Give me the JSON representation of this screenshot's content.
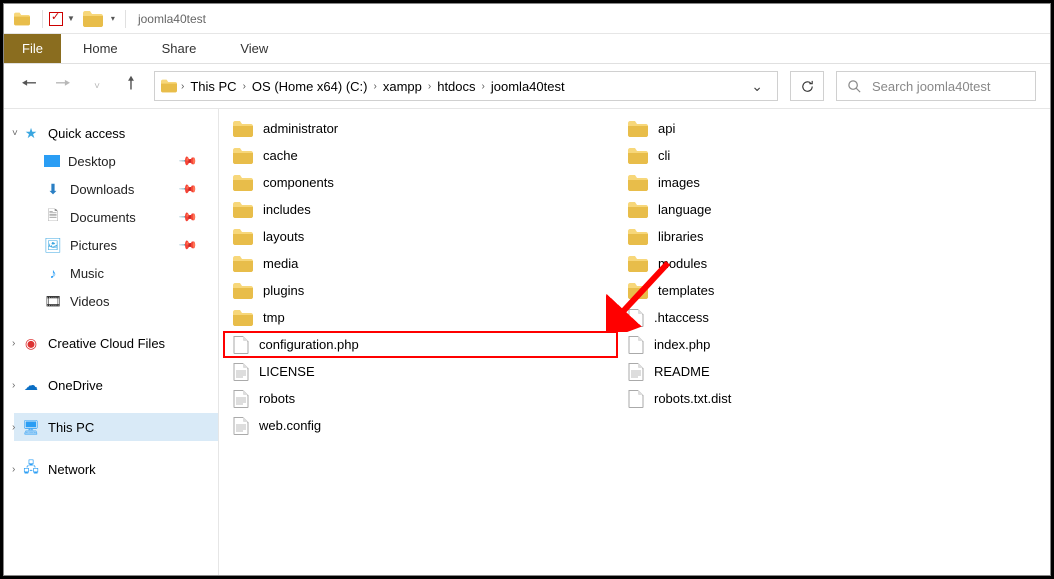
{
  "window": {
    "title": "joomla40test"
  },
  "ribbon": {
    "file": "File",
    "tabs": [
      "Home",
      "Share",
      "View"
    ]
  },
  "breadcrumb": [
    "This PC",
    "OS (Home x64) (C:)",
    "xampp",
    "htdocs",
    "joomla40test"
  ],
  "search": {
    "placeholder": "Search joomla40test"
  },
  "sidebar": {
    "quick_access": "Quick access",
    "quick_items": [
      "Desktop",
      "Downloads",
      "Documents",
      "Pictures",
      "Music",
      "Videos"
    ],
    "creative": "Creative Cloud Files",
    "onedrive": "OneDrive",
    "thispc": "This PC",
    "network": "Network"
  },
  "files": {
    "col1": [
      {
        "name": "administrator",
        "type": "folder"
      },
      {
        "name": "cache",
        "type": "folder"
      },
      {
        "name": "components",
        "type": "folder"
      },
      {
        "name": "includes",
        "type": "folder"
      },
      {
        "name": "layouts",
        "type": "folder"
      },
      {
        "name": "media",
        "type": "folder"
      },
      {
        "name": "plugins",
        "type": "folder"
      },
      {
        "name": "tmp",
        "type": "folder"
      },
      {
        "name": "configuration.php",
        "type": "file",
        "highlight": true
      },
      {
        "name": "LICENSE",
        "type": "text"
      },
      {
        "name": "robots",
        "type": "text"
      },
      {
        "name": "web.config",
        "type": "text"
      }
    ],
    "col2": [
      {
        "name": "api",
        "type": "folder"
      },
      {
        "name": "cli",
        "type": "folder"
      },
      {
        "name": "images",
        "type": "folder"
      },
      {
        "name": "language",
        "type": "folder"
      },
      {
        "name": "libraries",
        "type": "folder"
      },
      {
        "name": "modules",
        "type": "folder"
      },
      {
        "name": "templates",
        "type": "folder"
      },
      {
        "name": ".htaccess",
        "type": "file"
      },
      {
        "name": "index.php",
        "type": "file"
      },
      {
        "name": "README",
        "type": "text"
      },
      {
        "name": "robots.txt.dist",
        "type": "file"
      }
    ]
  }
}
